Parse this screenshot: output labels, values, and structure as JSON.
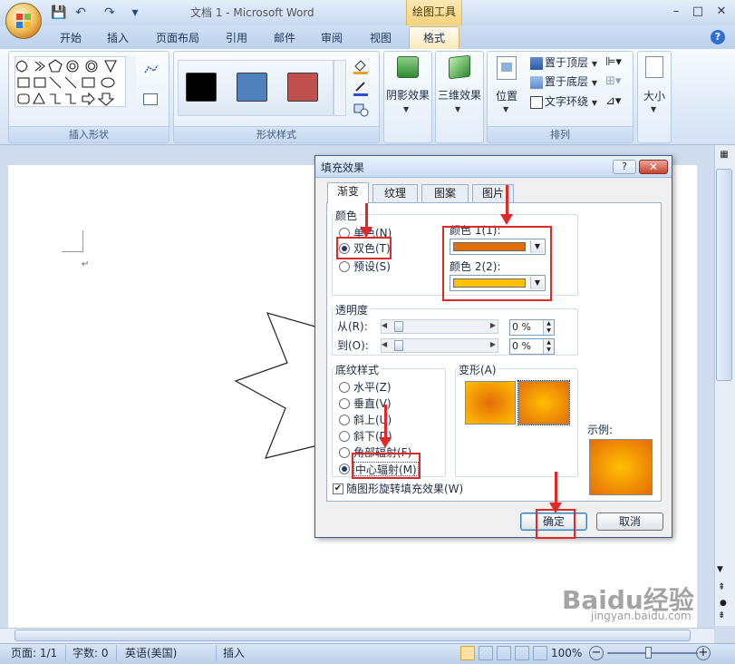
{
  "window": {
    "doc_title": "文档 1 - Microsoft Word",
    "context_tool": "绘图工具",
    "controls": {
      "minimize": "–",
      "maximize": "□",
      "close": "✕"
    }
  },
  "quick_access": {
    "save": "💾",
    "undo": "↶",
    "redo": "↷",
    "more": "▾"
  },
  "tabs": [
    "开始",
    "插入",
    "页面布局",
    "引用",
    "邮件",
    "审阅",
    "视图",
    "格式"
  ],
  "help": "?",
  "ribbon": {
    "groups": {
      "insert_shapes": "插入形状",
      "shape_styles": "形状样式",
      "arrange": "排列"
    },
    "style_swatches": [
      "#000000",
      "#4f81bd",
      "#c0504d"
    ],
    "buttons": {
      "shadow": "阴影效果",
      "threed": "三维效果",
      "position": "位置",
      "bring_front": "置于顶层",
      "send_back": "置于底层",
      "text_wrap": "文字环绕",
      "size": "大小"
    }
  },
  "dialog": {
    "title": "填充效果",
    "help": "?",
    "close": "✕",
    "tabs": [
      "渐变",
      "纹理",
      "图案",
      "图片"
    ],
    "color_section": "颜色",
    "color_options": [
      "单色(N)",
      "双色(T)",
      "预设(S)"
    ],
    "color1_label": "颜色 1(1):",
    "color2_label": "颜色 2(2):",
    "color1": "#e46c0a",
    "color2": "#ffc000",
    "transparency_section": "透明度",
    "from_label": "从(R):",
    "to_label": "到(O):",
    "from_value": "0 %",
    "to_value": "0 %",
    "shading_section": "底纹样式",
    "shading_options": [
      "水平(Z)",
      "垂直(V)",
      "斜上(U)",
      "斜下(D)",
      "角部辐射(F)",
      "中心辐射(M)"
    ],
    "variants_label": "变形(A)",
    "sample_label": "示例:",
    "rotate_checkbox": "随图形旋转填充效果(W)",
    "ok": "确定",
    "cancel": "取消"
  },
  "status": {
    "page": "页面: 1/1",
    "words": "字数: 0",
    "language": "英语(美国)",
    "mode": "插入",
    "zoom": "100%"
  },
  "watermark": {
    "brand": "Baidu经验",
    "url": "jingyan.baidu.com"
  }
}
